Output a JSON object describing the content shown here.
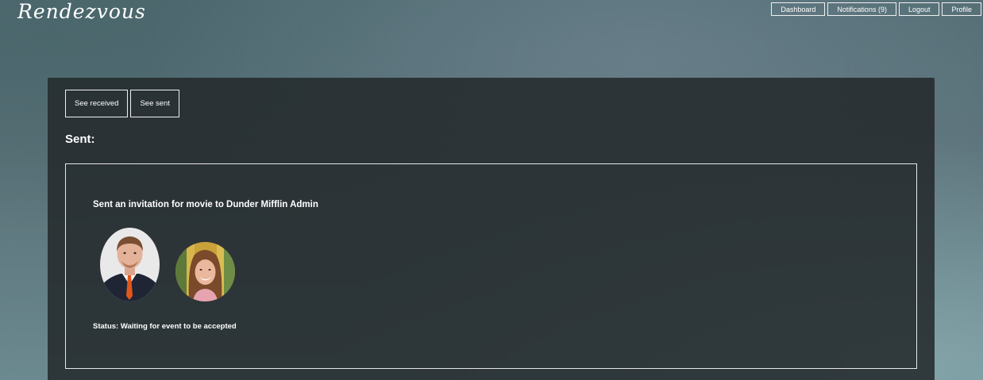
{
  "app": {
    "brand": "Rendezvous"
  },
  "nav": {
    "dashboard": "Dashboard",
    "notifications": "Notifications (9)",
    "logout": "Logout",
    "profile": "Profile"
  },
  "tabs": {
    "received": "See received",
    "sent": "See sent"
  },
  "section": {
    "title": "Sent:"
  },
  "invitation": {
    "heading": "Sent an invitation for movie to Dunder Mifflin Admin",
    "status": "Status: Waiting for event to be accepted",
    "participants": [
      {
        "avatar": "man-in-suit-photo"
      },
      {
        "avatar": "smiling-woman-photo"
      }
    ]
  }
}
